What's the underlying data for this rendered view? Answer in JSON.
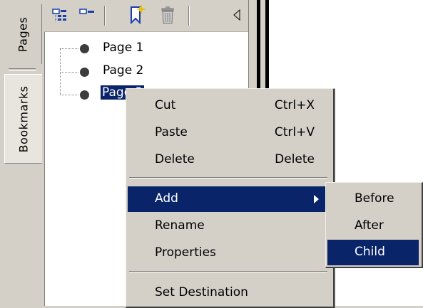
{
  "tabs": {
    "pages": "Pages",
    "bookmarks": "Bookmarks"
  },
  "toolbar": {
    "icons": [
      "expand-tree-icon",
      "collapse-tree-icon",
      "new-bookmark-icon",
      "delete-icon",
      "collapse-panel-icon"
    ]
  },
  "tree": {
    "items": [
      {
        "label": "Page 1",
        "selected": false
      },
      {
        "label": "Page 2",
        "selected": false
      },
      {
        "label": "Page 3",
        "selected": true
      }
    ]
  },
  "context_menu": {
    "items": [
      {
        "label": "Cut",
        "shortcut": "Ctrl+X"
      },
      {
        "label": "Paste",
        "shortcut": "Ctrl+V"
      },
      {
        "label": "Delete",
        "shortcut": "Delete"
      },
      {
        "label": "Add",
        "shortcut": "",
        "highlighted": true,
        "submenu": true
      },
      {
        "label": "Rename",
        "shortcut": ""
      },
      {
        "label": "Properties",
        "shortcut": ""
      },
      {
        "label": "Set Destination",
        "shortcut": ""
      }
    ]
  },
  "add_submenu": {
    "items": [
      {
        "label": "Before"
      },
      {
        "label": "After"
      },
      {
        "label": "Child",
        "highlighted": true
      }
    ]
  },
  "colors": {
    "selection": "#0a246a",
    "face": "#d4d0c8"
  }
}
